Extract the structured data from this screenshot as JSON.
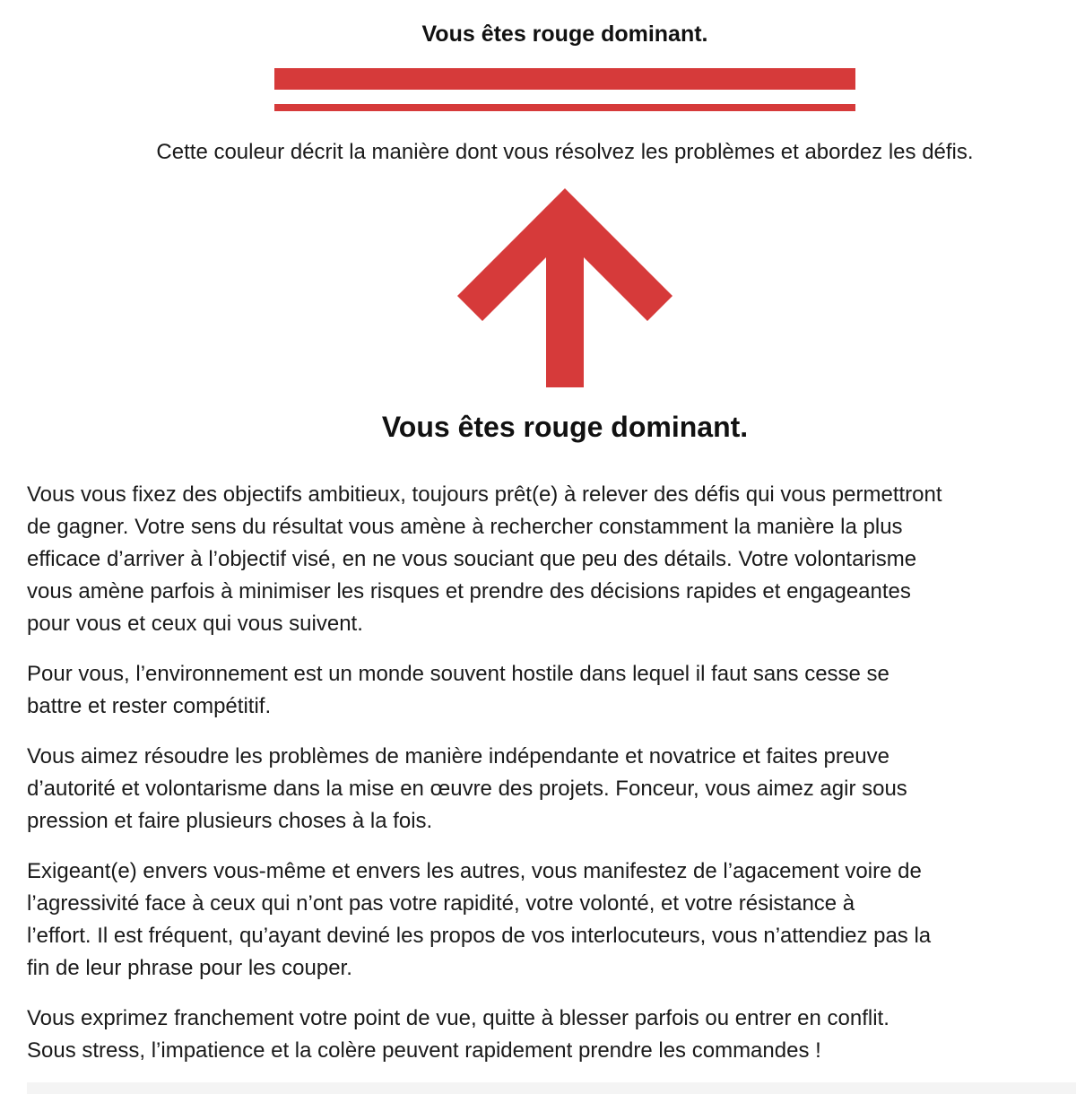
{
  "header": {
    "title": "Vous êtes rouge dominant.",
    "subtitle": "Cette couleur décrit la manière dont vous résolvez les problèmes et abordez les défis."
  },
  "accent_color": "#d63a3a",
  "icon": "arrow-up-icon",
  "section": {
    "title": "Vous êtes rouge dominant.",
    "paragraphs": [
      {
        "lines": [
          "Vous vous fixez des objectifs ambitieux, toujours prêt(e) à relever des défis qui vous permettront",
          "de gagner. Votre sens du résultat vous amène à rechercher constamment la manière la plus",
          "efficace d’arriver à l’objectif visé, en ne vous souciant que peu des détails. Votre volontarisme",
          "vous amène parfois à minimiser les risques et prendre des décisions rapides et engageantes",
          "pour vous et ceux qui vous suivent."
        ]
      },
      {
        "lines": [
          "Pour vous, l’environnement est un monde souvent hostile dans lequel il faut sans cesse se",
          "battre et rester compétitif."
        ]
      },
      {
        "lines": [
          "Vous aimez résoudre les problèmes de manière indépendante et novatrice et faites preuve",
          "d’autorité et volontarisme dans la mise en œuvre des projets. Fonceur, vous aimez agir sous",
          "pression et faire plusieurs choses à la fois."
        ]
      },
      {
        "lines": [
          "Exigeant(e) envers vous-même et envers les autres, vous manifestez de l’agacement voire de",
          "l’agressivité face à ceux qui n’ont pas votre rapidité, votre volonté, et votre résistance à",
          "l’effort. Il est fréquent, qu’ayant deviné les propos de vos interlocuteurs, vous n’attendiez pas la",
          "fin de leur phrase pour les couper."
        ]
      },
      {
        "lines": [
          "Vous exprimez franchement votre point de vue, quitte à blesser parfois ou entrer en conflit.",
          "Sous stress, l’impatience et la colère peuvent rapidement prendre les commandes !"
        ]
      }
    ]
  }
}
